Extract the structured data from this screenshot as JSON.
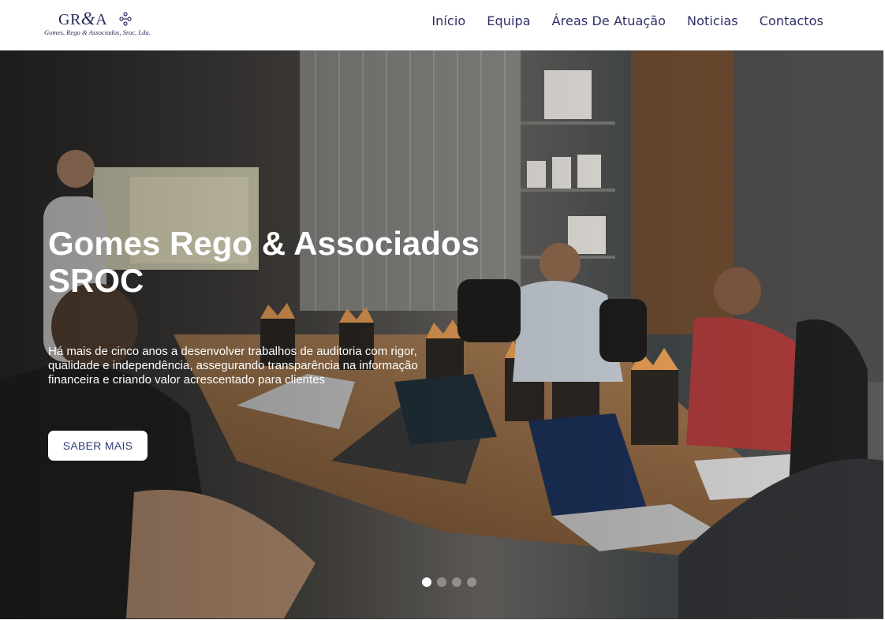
{
  "header": {
    "logo_mark": "GR",
    "logo_amp": "&",
    "logo_mark_end": "A",
    "logo_tagline": "Gomes, Rego & Associados, Sroc, Lda.",
    "nav": [
      {
        "label": "Início"
      },
      {
        "label": "Equipa"
      },
      {
        "label": "Áreas De Atuação"
      },
      {
        "label": "Noticias"
      },
      {
        "label": "Contactos"
      }
    ]
  },
  "hero": {
    "title_line1": "Gomes Rego & Associados",
    "title_line2": "SROC",
    "description": "Há mais de cinco anos a desenvolver trabalhos de auditoria com rigor, qualidade e independência, assegurando transparência na informação financeira e criando valor acrescentado para clientes",
    "button_label": "SABER MAIS",
    "slides": [
      {
        "active": true
      },
      {
        "active": false
      },
      {
        "active": false
      },
      {
        "active": false
      }
    ]
  },
  "colors": {
    "brand": "#2e2e66",
    "button_text": "#2e3f78",
    "hero_dark": "#343230"
  },
  "icons": {
    "logo_emblem": "logo-emblem-icon"
  }
}
